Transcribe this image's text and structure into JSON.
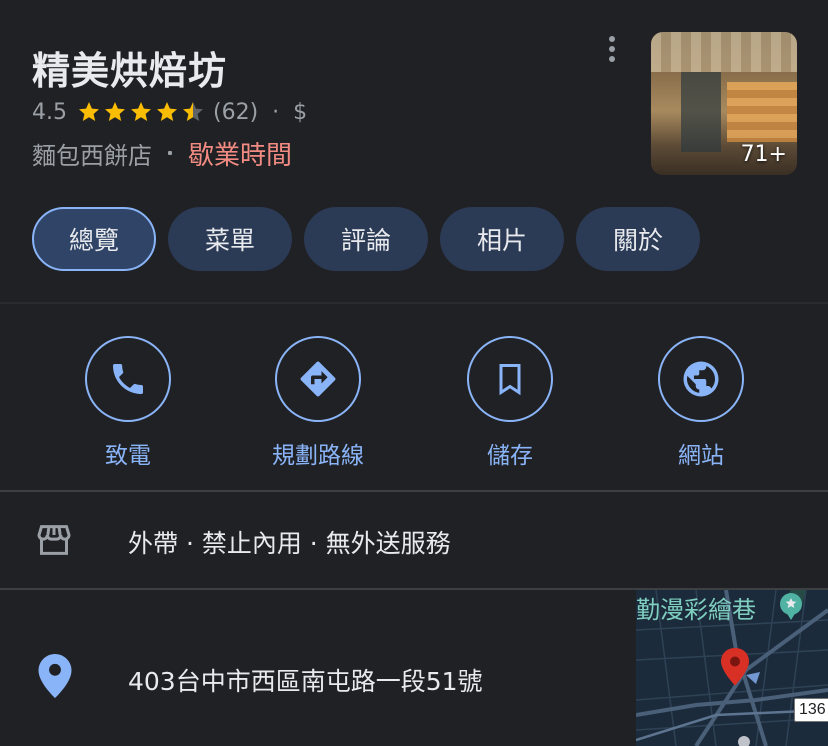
{
  "place": {
    "name": "精美烘焙坊",
    "rating": "4.5",
    "star_count": 4.5,
    "review_count": "(62)",
    "separator": "·",
    "price_level": "$",
    "category": "麵包西餅店",
    "hours_status": "歇業時間",
    "photo_count": "71+"
  },
  "tabs": [
    {
      "label": "總覽",
      "active": true
    },
    {
      "label": "菜單",
      "active": false
    },
    {
      "label": "評論",
      "active": false
    },
    {
      "label": "相片",
      "active": false
    },
    {
      "label": "關於",
      "active": false
    }
  ],
  "actions": [
    {
      "label": "致電",
      "icon": "phone-icon"
    },
    {
      "label": "規劃路線",
      "icon": "directions-icon"
    },
    {
      "label": "儲存",
      "icon": "bookmark-icon"
    },
    {
      "label": "網站",
      "icon": "globe-icon"
    }
  ],
  "service_options": {
    "text": "外帶 · 禁止內用 · 無外送服務",
    "icon": "storefront-icon"
  },
  "address": {
    "text": "403台中市西區南屯路一段51號",
    "icon": "location-pin-icon"
  },
  "map": {
    "poi_label": "勤漫彩繪巷",
    "route_number": "136"
  },
  "colors": {
    "background": "#202124",
    "accent_blue": "#8ab4f8",
    "hours_red": "#f28b82",
    "star_yellow": "#fbbc04",
    "tab_bg": "#2b3a55"
  }
}
